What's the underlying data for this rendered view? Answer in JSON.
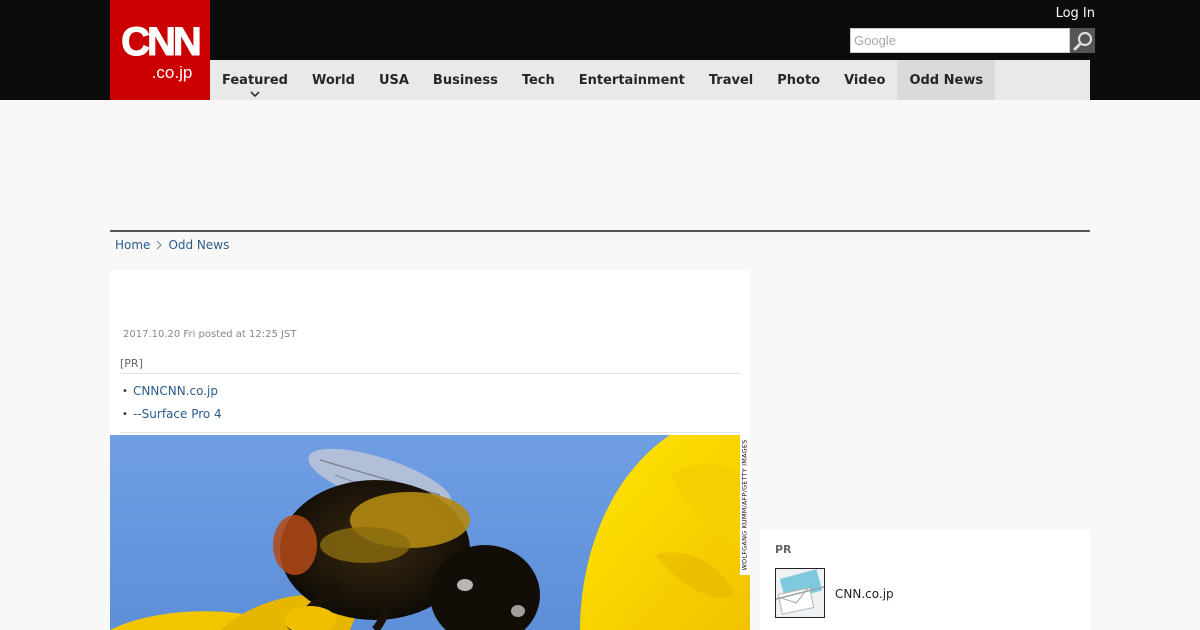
{
  "header": {
    "logo_main": "CNN",
    "logo_sub": ".co.jp",
    "login_label": "Log In",
    "search_placeholder": "Google",
    "search_icon": "magnifier-icon"
  },
  "nav": {
    "items": [
      {
        "label": "Featured",
        "has_dropdown": true
      },
      {
        "label": "World"
      },
      {
        "label": "USA"
      },
      {
        "label": "Business"
      },
      {
        "label": "Tech"
      },
      {
        "label": "Entertainment"
      },
      {
        "label": "Travel"
      },
      {
        "label": "Photo"
      },
      {
        "label": "Video"
      },
      {
        "label": "Odd News",
        "active": true
      }
    ]
  },
  "breadcrumb": {
    "home": "Home",
    "separator": "›",
    "current": "Odd News"
  },
  "article": {
    "dateline": "2017.10.20 Fri posted at 12:25 JST",
    "pr_label": "[PR]",
    "pr_links": [
      "CNNCNN.co.jp",
      "--Surface Pro 4"
    ],
    "photo_credit": "WOLFGANG KUMM/AFP/GETTY IMAGES",
    "photo_subject": "bumblebee-on-sunflower"
  },
  "sidebar_pr": {
    "label": "PR",
    "item_text": "CNN.co.jp",
    "thumb_icon": "envelope-icon"
  },
  "colors": {
    "brand_red": "#cc0000",
    "topbar": "#0c0c0c",
    "nav_bg": "#e9e9e9",
    "link": "#2a5d8c"
  }
}
